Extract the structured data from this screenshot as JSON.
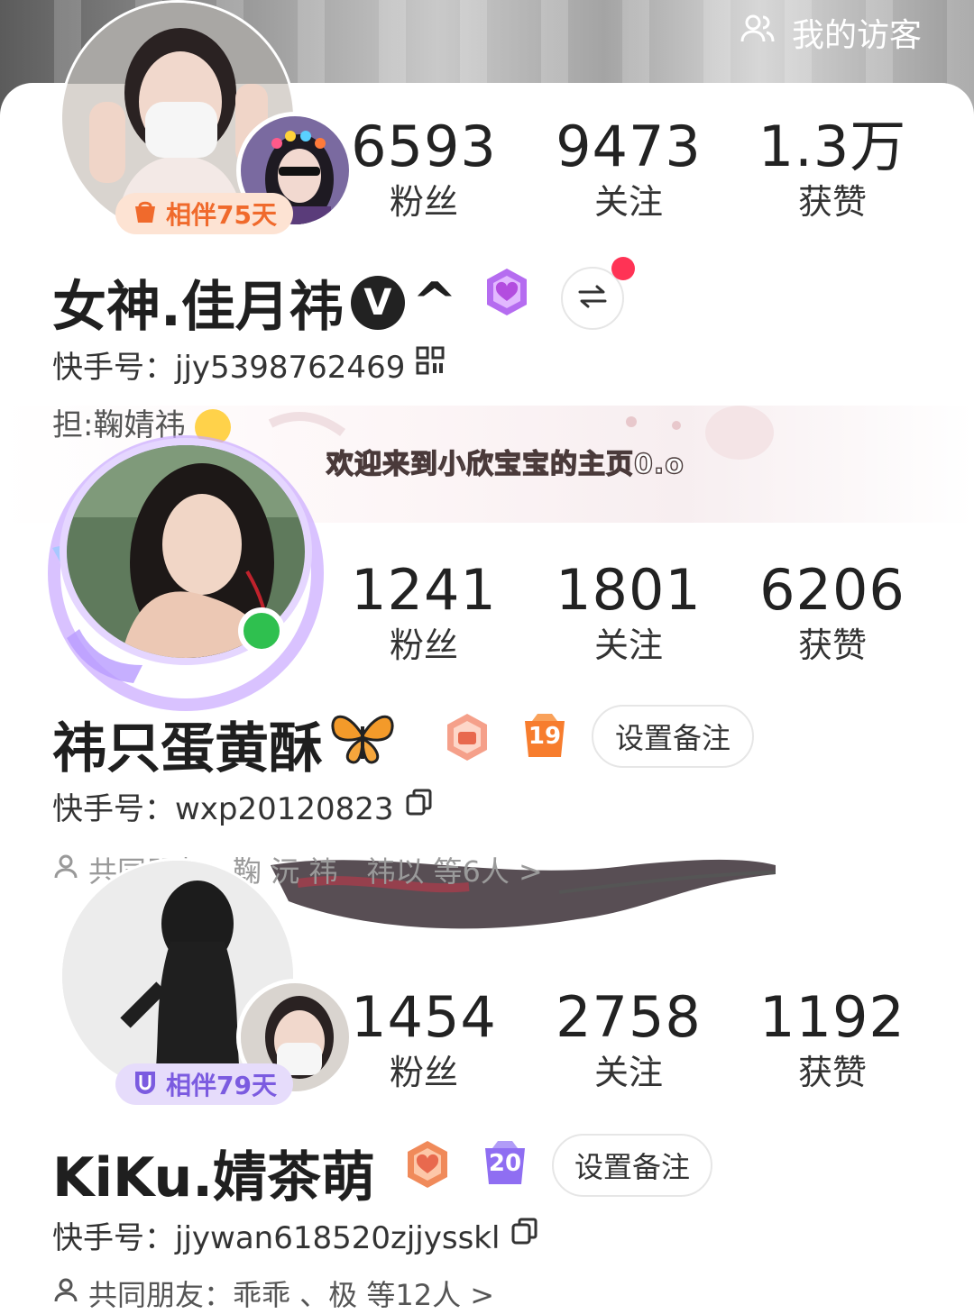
{
  "header": {
    "visitor_label": "我的访客"
  },
  "profiles": [
    {
      "stats": [
        {
          "num": "6593",
          "label": "粉丝"
        },
        {
          "num": "9473",
          "label": "关注"
        },
        {
          "num": "1.3万",
          "label": "获赞"
        }
      ],
      "companion": "相伴75天",
      "name": "女神.佳月祎",
      "name_suffix": "^",
      "verified": "V",
      "id_line": "快手号：jjy5398762469",
      "extra": "担:鞠婧祎"
    },
    {
      "welcome": "欢迎来到小欣宝宝的主页0.o",
      "stats": [
        {
          "num": "1241",
          "label": "粉丝"
        },
        {
          "num": "1801",
          "label": "关注"
        },
        {
          "num": "6206",
          "label": "获赞"
        }
      ],
      "name": "祎只蛋黄酥",
      "level": "19",
      "remark_button": "设置备注",
      "id_line": "快手号：wxp20120823",
      "friends_line": "共同朋友：鞠 沅 祎　祎以 等6人 >"
    },
    {
      "stats": [
        {
          "num": "1454",
          "label": "粉丝"
        },
        {
          "num": "2758",
          "label": "关注"
        },
        {
          "num": "1192",
          "label": "获赞"
        }
      ],
      "companion": "相伴79天",
      "name": "KiKu.婧茶萌",
      "level": "20",
      "remark_button": "设置备注",
      "id_line": "快手号：jjywan618520zjjysskl",
      "friends_line": "共同朋友：乖乖 、极 等12人 >"
    }
  ],
  "colors": {
    "orange_pill_bg": "#fde3d3",
    "orange_pill_text": "#f06a2c",
    "purple_pill_bg": "#e6dcfb",
    "purple_pill_text": "#7b5be0",
    "online": "#2fc04f",
    "red_dot": "#ff3355"
  }
}
